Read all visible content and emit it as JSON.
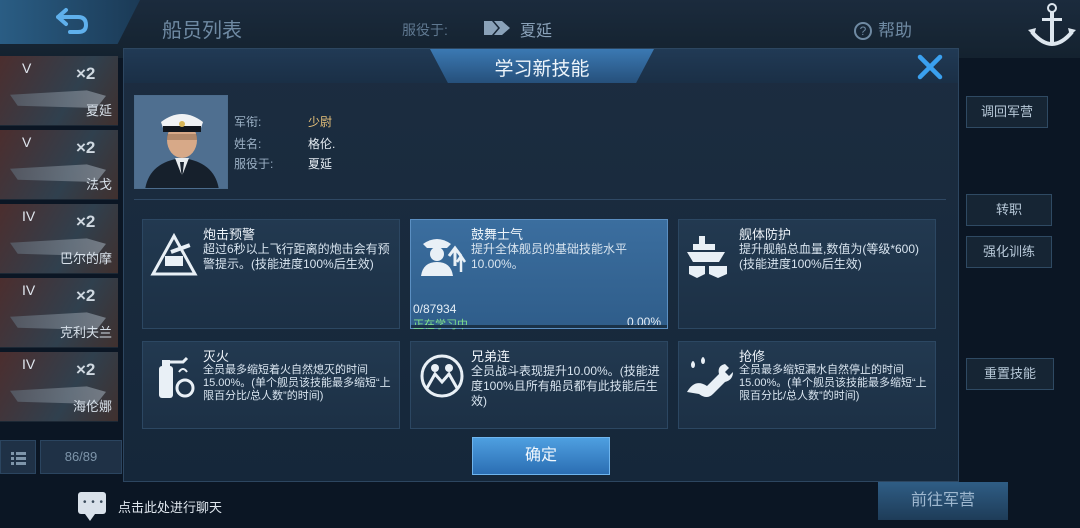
{
  "background": {
    "title": "船员列表",
    "serve_label": "服役于:",
    "serve_ship": "夏延",
    "help": "帮助",
    "crew_list": [
      {
        "tier": "V",
        "multiplier": "×2",
        "name": "夏延"
      },
      {
        "tier": "V",
        "multiplier": "×2",
        "name": "法戈"
      },
      {
        "tier": "IV",
        "multiplier": "×2",
        "name": "巴尔的摩"
      },
      {
        "tier": "IV",
        "multiplier": "×2",
        "name": "克利夫兰"
      },
      {
        "tier": "IV",
        "multiplier": "×2",
        "name": "海伦娜"
      }
    ],
    "crew_count": "86/89",
    "chat_hint": "点击此处进行聊天",
    "right_buttons": [
      "调回军营",
      "转职",
      "强化训练",
      "重置技能"
    ],
    "goto_barracks": "前往军营"
  },
  "modal": {
    "title": "学习新技能",
    "profile": {
      "rank_label": "军衔:",
      "rank_value": "少尉",
      "name_label": "姓名:",
      "name_value": "格伦.",
      "serve_label": "服役于:",
      "serve_value": "夏延"
    },
    "skills": [
      {
        "name": "炮击预警",
        "icon": "turret-warning-icon",
        "desc": "超过6秒以上飞行距离的炮击会有预警提示。(技能进度100%后生效)"
      },
      {
        "name": "鼓舞士气",
        "icon": "officer-rally-icon",
        "desc": "提升全体舰员的基础技能水平10.00%。",
        "active": true,
        "progress_text": "0/87934",
        "status": "正在学习中",
        "percent": "0.00%",
        "progress": 0
      },
      {
        "name": "舰体防护",
        "icon": "hull-shield-icon",
        "desc": "提升舰船总血量,数值为(等级*600)(技能进度100%后生效)"
      },
      {
        "name": "灭火",
        "icon": "fire-extinguisher-icon",
        "desc": "全员最多缩短着火自然熄灭的时间15.00%。(单个舰员该技能最多缩短“上限百分比/总人数”的时间)"
      },
      {
        "name": "兄弟连",
        "icon": "brotherhood-icon",
        "desc": "全员战斗表现提升10.00%。(技能进度100%且所有船员都有此技能后生效)"
      },
      {
        "name": "抢修",
        "icon": "repair-wrench-icon",
        "desc": "全员最多缩短漏水自然停止的时间15.00%。(单个舰员该技能最多缩短“上限百分比/总人数”的时间)"
      }
    ],
    "confirm": "确定"
  },
  "colors": {
    "accent": "#3b79b3",
    "progress": "#6fd27a",
    "rank": "#e8c27a"
  }
}
